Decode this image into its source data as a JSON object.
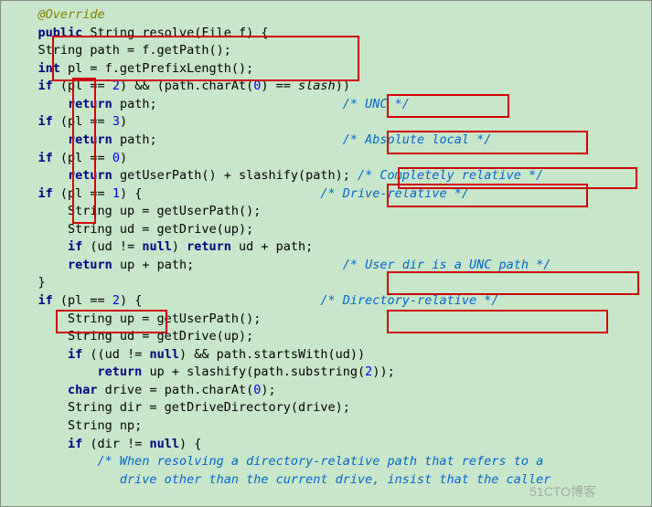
{
  "code": {
    "l1a": "@Override",
    "l2a": "public",
    "l2b": " String resolve(File f) {",
    "l3a": "    String path = f.getPath();",
    "l4a": "    ",
    "l4b": "int",
    "l4c": " pl = f.getPrefixLength();",
    "l5a": "    ",
    "l5b": "if",
    "l5c": " (pl == ",
    "l5d": "2",
    "l5e": ") && (path.charAt(",
    "l5f": "0",
    "l5g": ") == ",
    "l5h": "slash",
    "l5i": "))",
    "l6a": "        ",
    "l6b": "return",
    "l6c": " path;                         ",
    "l6d": "/* UNC */",
    "l7a": "    ",
    "l7b": "if",
    "l7c": " (pl == ",
    "l7d": "3",
    "l7e": ")",
    "l8a": "        ",
    "l8b": "return",
    "l8c": " path;                         ",
    "l8d": "/* Absolute local */",
    "l9a": "    ",
    "l9b": "if",
    "l9c": " (pl == ",
    "l9d": "0",
    "l9e": ")",
    "l10a": "        ",
    "l10b": "return",
    "l10c": " getUserPath() + slashify(path); ",
    "l10d": "/* Completely relative */",
    "l11a": "    ",
    "l11b": "if",
    "l11c": " (pl == ",
    "l11d": "1",
    "l11e": ") {                        ",
    "l11f": "/* Drive-relative */",
    "l12a": "        String up = getUserPath();",
    "l13a": "        String ud = getDrive(up);",
    "l14a": "        ",
    "l14b": "if",
    "l14c": " (ud != ",
    "l14d": "null",
    "l14e": ") ",
    "l14f": "return",
    "l14g": " ud + path;",
    "l15a": "        ",
    "l15b": "return",
    "l15c": " up + path;                    ",
    "l15d": "/* User dir is a UNC path */",
    "l16a": "    }",
    "l17a": "    ",
    "l17b": "if",
    "l17c": " (pl == ",
    "l17d": "2",
    "l17e": ") {                        ",
    "l17f": "/* Directory-relative */",
    "l18a": "        String up = getUserPath();",
    "l19a": "        String ud = getDrive(up);",
    "l20a": "        ",
    "l20b": "if",
    "l20c": " ((ud != ",
    "l20d": "null",
    "l20e": ") && path.startsWith(ud))",
    "l21a": "            ",
    "l21b": "return",
    "l21c": " up + slashify(path.substring(",
    "l21d": "2",
    "l21e": "));",
    "l22a": "        ",
    "l22b": "char",
    "l22c": " drive = path.charAt(",
    "l22d": "0",
    "l22e": ");",
    "l23a": "        String dir = getDriveDirectory(drive);",
    "l24a": "        String np;",
    "l25a": "        ",
    "l25b": "if",
    "l25c": " (dir != ",
    "l25d": "null",
    "l25e": ") {",
    "l26a": "            ",
    "l26b": "/* When resolving a directory-relative path that refers to a",
    "l27a": "               drive other than the current drive, insist that the caller"
  },
  "wm": "51CTO博客"
}
